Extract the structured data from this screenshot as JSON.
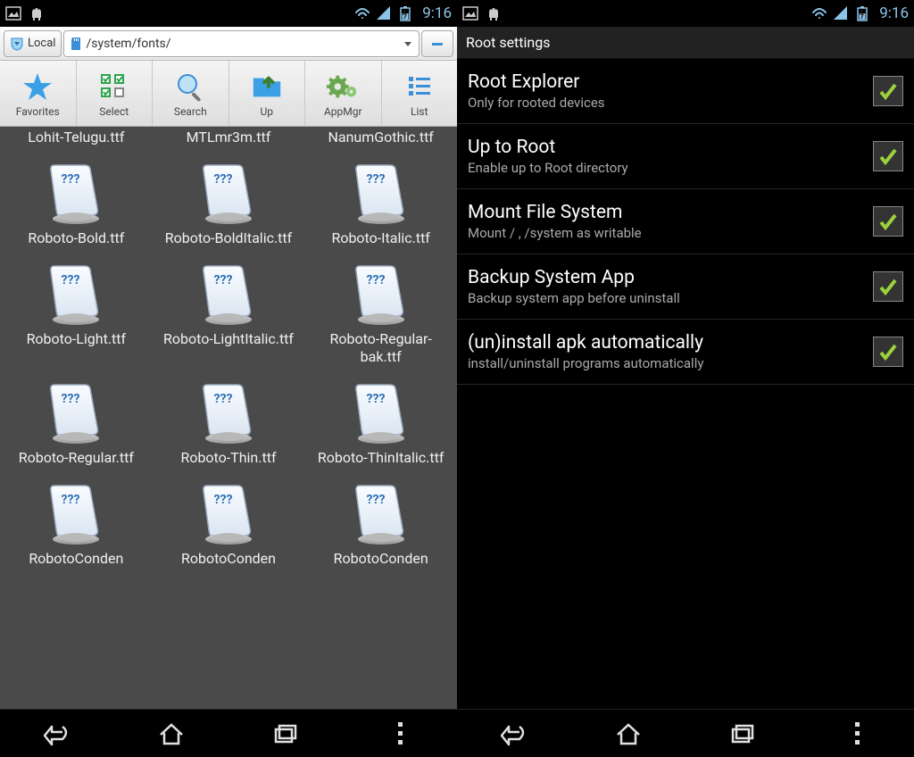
{
  "status": {
    "time": "9:16"
  },
  "filemanager": {
    "location_label": "Local",
    "path": "/system/fonts/",
    "toolbar": [
      {
        "label": "Favorites",
        "icon": "star"
      },
      {
        "label": "Select",
        "icon": "select"
      },
      {
        "label": "Search",
        "icon": "search"
      },
      {
        "label": "Up",
        "icon": "up"
      },
      {
        "label": "AppMgr",
        "icon": "gear"
      },
      {
        "label": "List",
        "icon": "list"
      }
    ],
    "partial_row": [
      "Lohit-Telugu.ttf",
      "MTLmr3m.ttf",
      "NanumGothic.ttf"
    ],
    "files": [
      "Roboto-Bold.ttf",
      "Roboto-BoldItalic.ttf",
      "Roboto-Italic.ttf",
      "Roboto-Light.ttf",
      "Roboto-LightItalic.ttf",
      "Roboto-Regular-bak.ttf",
      "Roboto-Regular.ttf",
      "Roboto-Thin.ttf",
      "Roboto-ThinItalic.ttf",
      "RobotoConden",
      "RobotoConden",
      "RobotoConden"
    ]
  },
  "settings": {
    "header": "Root settings",
    "items": [
      {
        "title": "Root Explorer",
        "sub": "Only for rooted devices",
        "checked": true
      },
      {
        "title": "Up to Root",
        "sub": "Enable up to Root directory",
        "checked": true
      },
      {
        "title": "Mount File System",
        "sub": "Mount / , /system as writable",
        "checked": true
      },
      {
        "title": "Backup System App",
        "sub": "Backup system app before uninstall",
        "checked": true
      },
      {
        "title": "(un)install apk automatically",
        "sub": "install/uninstall programs automatically",
        "checked": true
      }
    ]
  }
}
